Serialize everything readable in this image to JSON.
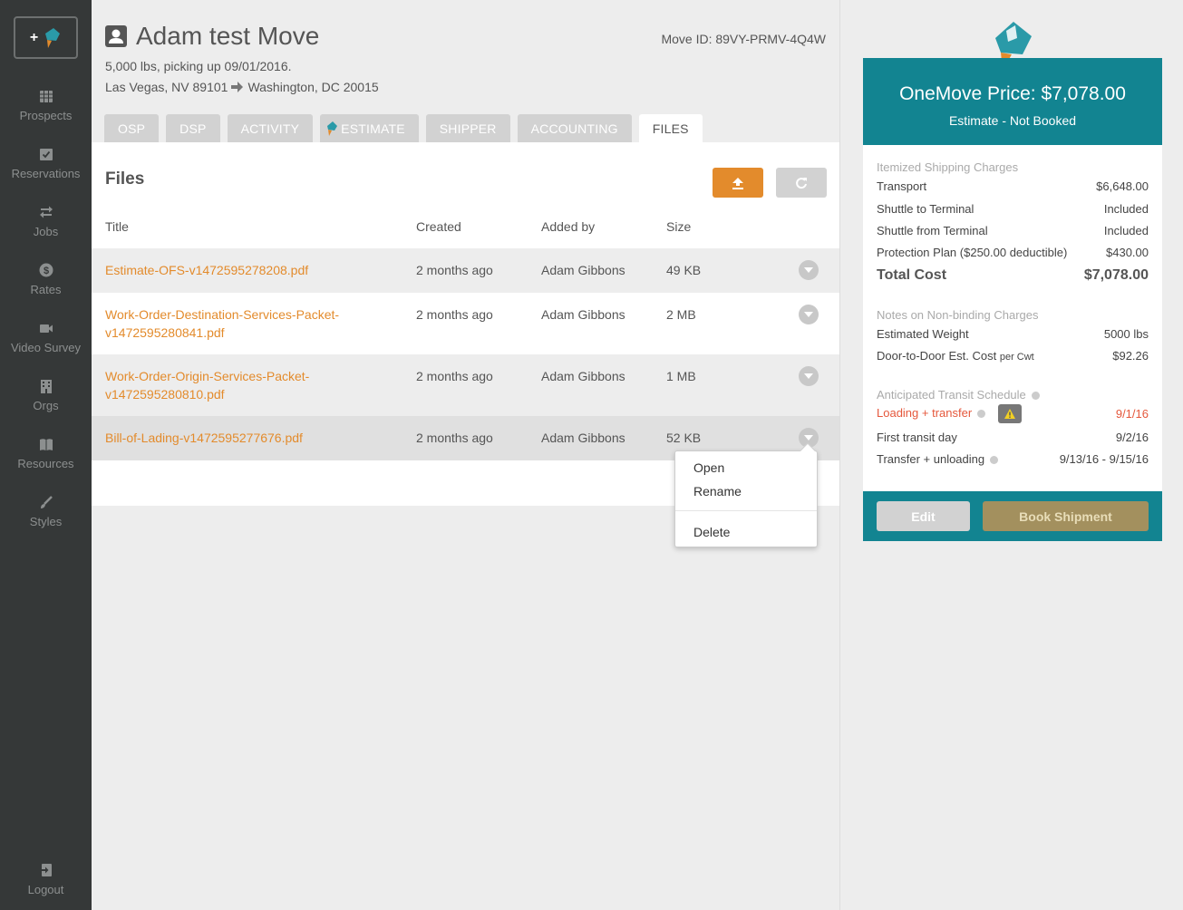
{
  "sidebar": {
    "new_label": "+",
    "items": [
      {
        "label": "Prospects",
        "icon": "grid-icon"
      },
      {
        "label": "Reservations",
        "icon": "calendar-check-icon"
      },
      {
        "label": "Jobs",
        "icon": "swap-arrows-icon"
      },
      {
        "label": "Rates",
        "icon": "dollar-icon"
      },
      {
        "label": "Video Survey",
        "icon": "video-camera-icon"
      },
      {
        "label": "Orgs",
        "icon": "building-icon"
      },
      {
        "label": "Resources",
        "icon": "book-icon"
      },
      {
        "label": "Styles",
        "icon": "brush-icon"
      }
    ],
    "logout_label": "Logout"
  },
  "header": {
    "title": "Adam test Move",
    "move_id": "Move ID: 89VY-PRMV-4Q4W",
    "weight_line": "5,000 lbs, picking up 09/01/2016.",
    "origin": "Las Vegas, NV 89101",
    "destination": "Washington, DC 20015"
  },
  "tabs": [
    {
      "label": "OSP",
      "active": false
    },
    {
      "label": "DSP",
      "active": false
    },
    {
      "label": "ACTIVITY",
      "active": false
    },
    {
      "label": "ESTIMATE",
      "active": false
    },
    {
      "label": "SHIPPER",
      "active": false
    },
    {
      "label": "ACCOUNTING",
      "active": false
    },
    {
      "label": "FILES",
      "active": true
    }
  ],
  "files": {
    "heading": "Files",
    "columns": {
      "title": "Title",
      "created": "Created",
      "added_by": "Added by",
      "size": "Size"
    },
    "rows": [
      {
        "title_l1": "Estimate-OFS-v1472595278208.pdf",
        "title_l2": "",
        "created": "2 months ago",
        "added_by": "Adam Gibbons",
        "size": "49 KB"
      },
      {
        "title_l1": "Work-Order-Destination-Services-Packet-",
        "title_l2": "v1472595280841.pdf",
        "created": "2 months ago",
        "added_by": "Adam Gibbons",
        "size": "2 MB"
      },
      {
        "title_l1": "Work-Order-Origin-Services-Packet-",
        "title_l2": "v1472595280810.pdf",
        "created": "2 months ago",
        "added_by": "Adam Gibbons",
        "size": "1 MB"
      },
      {
        "title_l1": "Bill-of-Lading-v1472595277676.pdf",
        "title_l2": "",
        "created": "2 months ago",
        "added_by": "Adam Gibbons",
        "size": "52 KB"
      }
    ],
    "menu": {
      "open": "Open",
      "rename": "Rename",
      "delete": "Delete"
    }
  },
  "price": {
    "title": "OneMove Price: $7,078.00",
    "status": "Estimate - Not Booked",
    "itemized_title": "Itemized Shipping Charges",
    "itemized": [
      {
        "label": "Transport",
        "value": "$6,648.00"
      },
      {
        "label": "Shuttle to Terminal",
        "value": "Included"
      },
      {
        "label": "Shuttle from Terminal",
        "value": "Included"
      },
      {
        "label": "Protection Plan ($250.00 deductible)",
        "value": "$430.00"
      }
    ],
    "total_label": "Total Cost",
    "total_value": "$7,078.00",
    "notes_title": "Notes on Non-binding Charges",
    "est_weight_label": "Estimated Weight",
    "est_weight_value": "5000 lbs",
    "d2d_label": "Door-to-Door Est. Cost",
    "d2d_suffix": "per Cwt",
    "d2d_value": "$92.26",
    "transit_title": "Anticipated Transit Schedule",
    "loading_label": "Loading + transfer",
    "loading_value": "9/1/16",
    "first_transit_label": "First transit day",
    "first_transit_value": "9/2/16",
    "unloading_label": "Transfer + unloading",
    "unloading_value": "9/13/16 - 9/15/16",
    "edit_label": "Edit",
    "book_label": "Book Shipment"
  },
  "colors": {
    "accent": "#e38b2c",
    "teal": "#128491",
    "gold": "#a3905e",
    "sidebar": "#353838"
  }
}
